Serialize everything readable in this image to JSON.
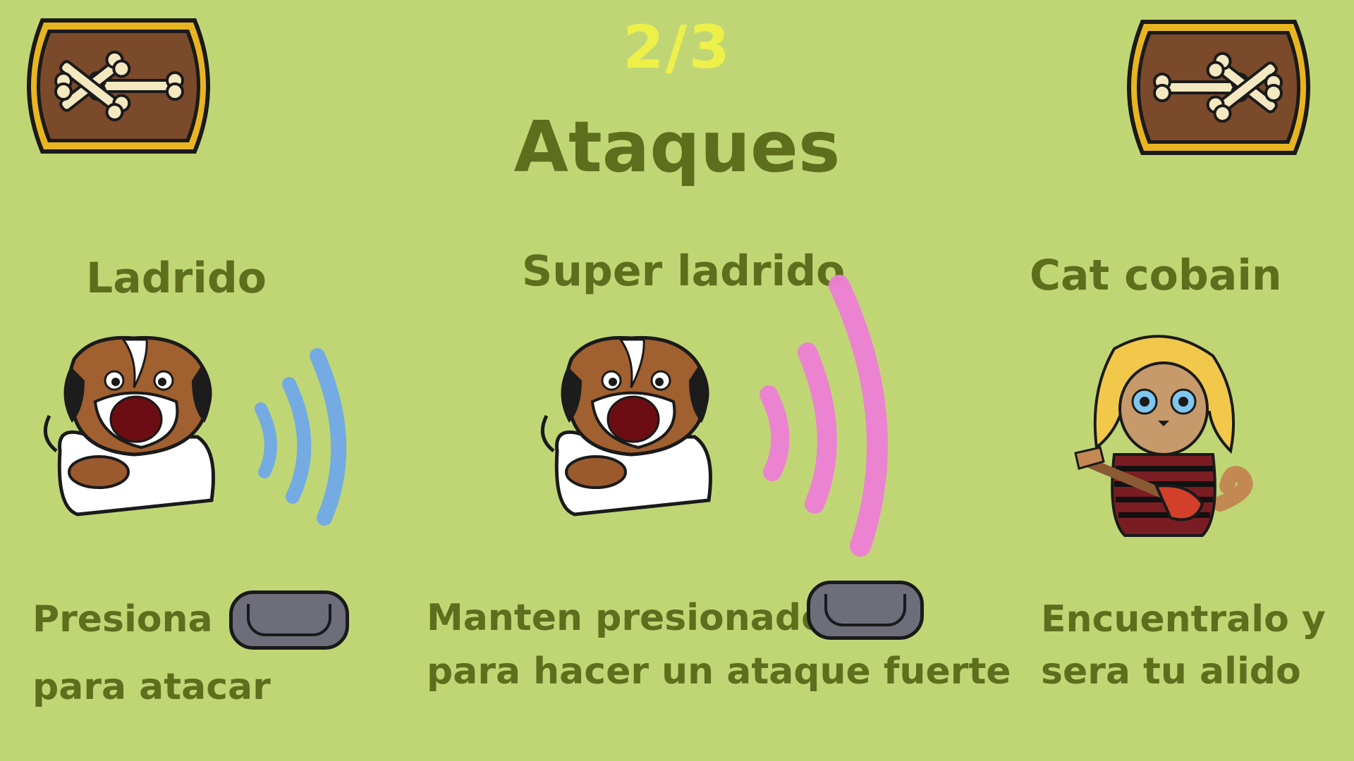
{
  "page": {
    "counter": "2/3",
    "title": "Ataques"
  },
  "nav": {
    "prev_icon": "bone-arrow-left-icon",
    "next_icon": "bone-arrow-right-icon"
  },
  "cards": [
    {
      "title": "Ladrido",
      "line1": "Presiona",
      "line2": "para atacar",
      "key_icon": "key-button-icon",
      "illustration": "dog-barking-blue-waves"
    },
    {
      "title": "Super ladrido",
      "line1": "Manten presionado",
      "line2": "para hacer un ataque fuerte",
      "key_icon": "key-button-icon",
      "illustration": "dog-barking-pink-waves"
    },
    {
      "title": "Cat cobain",
      "line1": "Encuentralo y",
      "line2": "sera tu alido",
      "illustration": "cat-with-guitar"
    }
  ],
  "colors": {
    "background": "#c0d675",
    "text": "#5e6e1d",
    "counter": "#eef04a",
    "wave_blue": "#6fa9e8",
    "wave_pink": "#ee7fd6",
    "plaque": "#7a4a2a",
    "plaque_border": "#e8b521"
  }
}
